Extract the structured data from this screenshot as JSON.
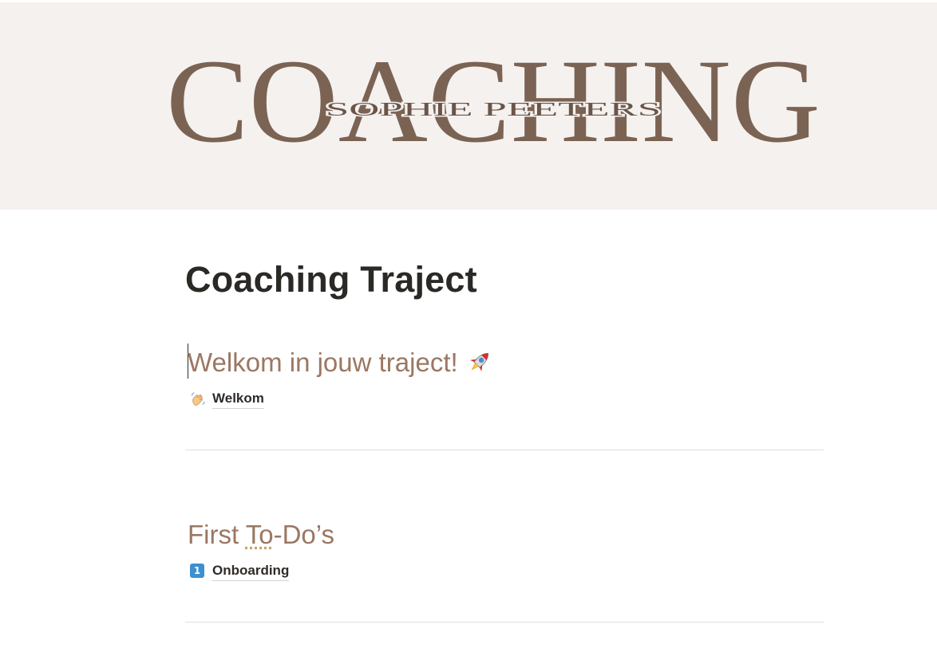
{
  "cover": {
    "big_text": "COACHING",
    "name_text": "SOPHIE PEETERS",
    "text_color": "#7b6354",
    "background": "#f5f1ee"
  },
  "page": {
    "title": "Coaching Traject"
  },
  "sections": [
    {
      "heading": "Welkom in jouw traject!",
      "heading_icon": "rocket-icon",
      "links": [
        {
          "icon": "waving-hand-icon",
          "label": "Welkom"
        }
      ]
    },
    {
      "heading_part1": "First ",
      "heading_part2": "To",
      "heading_part3": "-Do’s",
      "links": [
        {
          "icon": "keycap-one-icon",
          "icon_text": "1",
          "label": "Onboarding"
        }
      ]
    }
  ],
  "colors": {
    "heading": "#9b7763",
    "title": "#2b2926",
    "keycap": "#3d8fd1"
  }
}
